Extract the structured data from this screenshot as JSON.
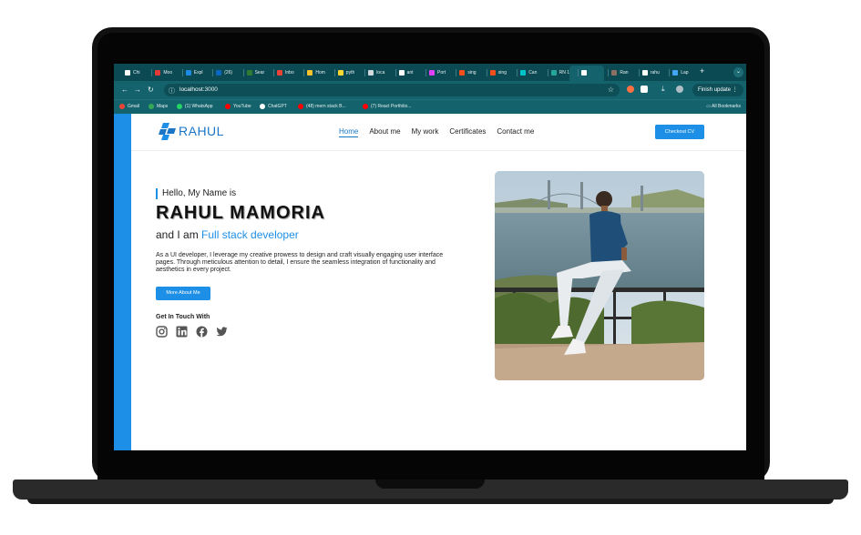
{
  "browser": {
    "tabs": [
      {
        "label": "Chi",
        "icon": "chatgpt-icon",
        "color": "#ffffff"
      },
      {
        "label": "Moo",
        "icon": "red-circle-icon",
        "color": "#e53935"
      },
      {
        "label": "Expl",
        "icon": "doc-icon",
        "color": "#1e88e5"
      },
      {
        "label": "(26)",
        "icon": "linkedin-icon",
        "color": "#0a66c2"
      },
      {
        "label": "Sear",
        "icon": "search-tab-icon",
        "color": "#2e7d32"
      },
      {
        "label": "Inbo",
        "icon": "gmail-icon",
        "color": "#ea4335"
      },
      {
        "label": "Hom",
        "icon": "home-tab-icon",
        "color": "#fbc02d"
      },
      {
        "label": "pyth",
        "icon": "python-icon",
        "color": "#fdd835"
      },
      {
        "label": "loca",
        "icon": "globe-icon",
        "color": "#cfd8dc"
      },
      {
        "label": "ant",
        "icon": "google-icon",
        "color": "#ffffff"
      },
      {
        "label": "Port",
        "icon": "portfolio-icon",
        "color": "#e040fb"
      },
      {
        "label": "sing",
        "icon": "figma-icon",
        "color": "#f24e1e"
      },
      {
        "label": "sing",
        "icon": "figma-icon",
        "color": "#f24e1e"
      },
      {
        "label": "Can",
        "icon": "canva-icon",
        "color": "#00c4cc"
      },
      {
        "label": "RN 1",
        "icon": "rn-icon",
        "color": "#26a69a"
      },
      {
        "label": "",
        "icon": "active-tab-icon",
        "color": "#ffffff"
      },
      {
        "label": "Ran",
        "icon": "photo-tab-icon",
        "color": "#8d6e63"
      },
      {
        "label": "rahu",
        "icon": "github-icon",
        "color": "#ffffff"
      },
      {
        "label": "Lap",
        "icon": "laptop-tab-icon",
        "color": "#42a5f5"
      }
    ],
    "new_tab": "+",
    "url_host": "localhost",
    "url_port": ":3000",
    "finish_update": "Finish update",
    "bookmarks": [
      {
        "label": "Gmail",
        "icon": "gmail-icon",
        "color": "#ea4335"
      },
      {
        "label": "Maps",
        "icon": "maps-icon",
        "color": "#34a853"
      },
      {
        "label": "(1) WhatsApp",
        "icon": "whatsapp-icon",
        "color": "#25d366"
      },
      {
        "label": "YouTube",
        "icon": "youtube-icon",
        "color": "#ff0000"
      },
      {
        "label": "ChatGPT",
        "icon": "chatgpt-icon",
        "color": "#ffffff"
      },
      {
        "label": "(48) mern stack B...",
        "icon": "youtube-icon",
        "color": "#ff0000"
      },
      {
        "label": "(7) React Portfolio...",
        "icon": "youtube-icon",
        "color": "#ff0000"
      }
    ],
    "all_bookmarks": "All Bookmarks"
  },
  "site": {
    "logo_text": "RAHUL",
    "nav": [
      "Home",
      "About me",
      "My work",
      "Certificates",
      "Contact me"
    ],
    "active_nav": "Home",
    "checkout_cv": "Checkout CV",
    "hello": "Hello, My Name is",
    "name": "RAHUL MAMORIA",
    "role_prefix": "and I am",
    "role_highlight": "Full stack developer",
    "description": "As a UI developer, I leverage my creative prowess to design and craft visually engaging user interface pages. Through meticulous attention to detail, I ensure the seamless integration of functionality and aesthetics in every project.",
    "more_about": "More About Me",
    "get_in_touch": "Get In Touch With",
    "social": [
      "instagram-icon",
      "linkedin-icon",
      "facebook-icon",
      "twitter-icon"
    ]
  },
  "colors": {
    "accent": "#1d8fe6",
    "chrome": "#13626c",
    "tabbar": "#0c4a53"
  }
}
